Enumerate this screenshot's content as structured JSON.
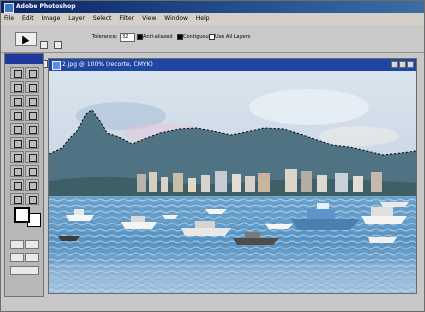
{
  "window": {
    "title": "Adobe Photoshop"
  },
  "menubar": {
    "items": [
      "File",
      "Edit",
      "Image",
      "Layer",
      "Select",
      "Filter",
      "View",
      "Window",
      "Help"
    ]
  },
  "options": {
    "tolerance_label": "Tolerance:",
    "tolerance_value": "32",
    "anti_aliased_label": "Anti-aliased",
    "contiguous_label": "Contiguous",
    "use_all_layers_label": "Use All Layers"
  },
  "document": {
    "title": "2.jpg @ 100% (recorte, CMYK)"
  }
}
